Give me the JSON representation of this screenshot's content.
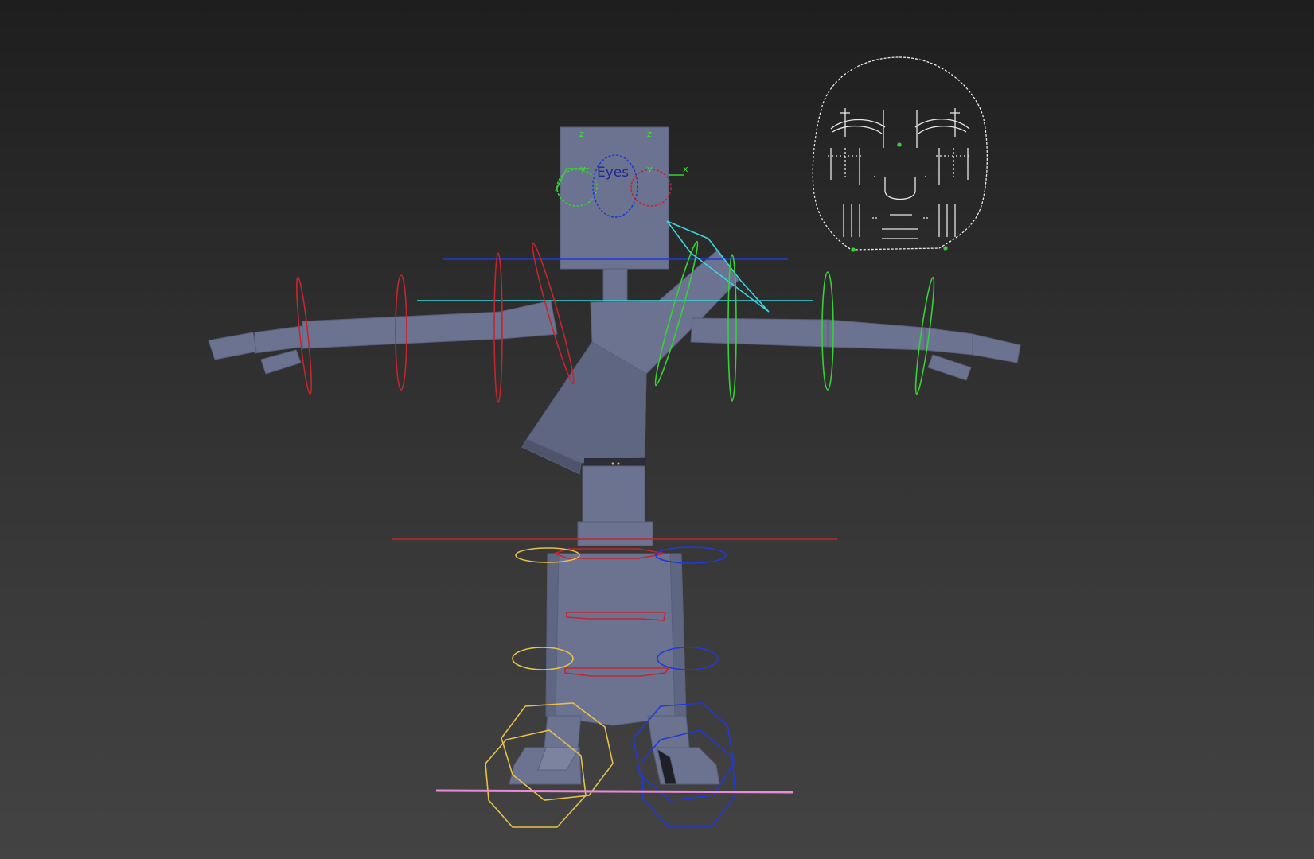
{
  "viewport": {
    "eye_label": "Eyes",
    "axis_labels": {
      "z_left": "z",
      "z_right": "z",
      "y_left": "y",
      "y_right": "y",
      "x": "x"
    }
  },
  "colors": {
    "mesh": "#6b7391",
    "mesh_dark": "#4e546b",
    "right_side": "#c4262f",
    "left_side": "#37d137",
    "center_blue": "#1f3ad8",
    "spine_cyan": "#39d6e0",
    "foot_yellow": "#e6c04a",
    "ground_pink": "#e88ad8",
    "facial_rig": "#e8e8e8"
  }
}
